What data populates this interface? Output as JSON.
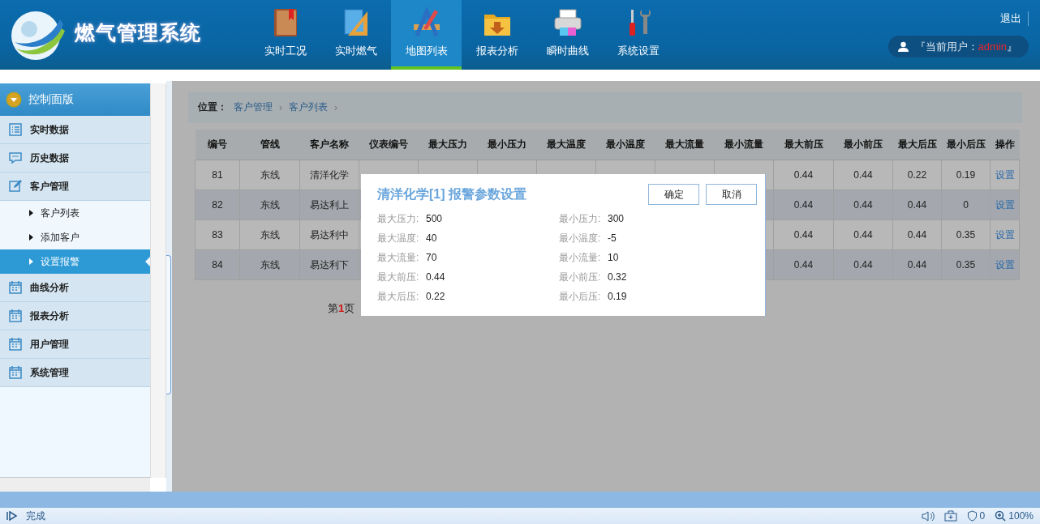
{
  "header": {
    "title": "燃气管理系统",
    "nav": [
      {
        "label": "实时工况",
        "selected": false
      },
      {
        "label": "实时燃气",
        "selected": false
      },
      {
        "label": "地图列表",
        "selected": true
      },
      {
        "label": "报表分析",
        "selected": false
      },
      {
        "label": "瞬时曲线",
        "selected": false
      },
      {
        "label": "系统设置",
        "selected": false
      }
    ],
    "logout": "退出",
    "user": {
      "prefix": "『当前用户：",
      "name": "admin",
      "suffix": "』"
    }
  },
  "sidebar": {
    "title": "控制面版",
    "items": [
      {
        "label": "实时数据"
      },
      {
        "label": "历史数据"
      },
      {
        "label": "客户管理",
        "children": [
          {
            "label": "客户列表",
            "selected": false
          },
          {
            "label": "添加客户",
            "selected": false
          },
          {
            "label": "设置报警",
            "selected": true
          }
        ]
      },
      {
        "label": "曲线分析"
      },
      {
        "label": "报表分析"
      },
      {
        "label": "用户管理"
      },
      {
        "label": "系统管理"
      }
    ]
  },
  "breadcrumb": {
    "label": "位置：",
    "items": [
      {
        "text": "客户管理",
        "kind": "link"
      },
      {
        "text": "›",
        "kind": "sep"
      },
      {
        "text": "客户列表",
        "kind": "link"
      },
      {
        "text": "›",
        "kind": "sep"
      }
    ]
  },
  "table": {
    "columns": [
      "编号",
      "管线",
      "客户名称",
      "仪表编号",
      "最大压力",
      "最小压力",
      "最大温度",
      "最小温度",
      "最大流量",
      "最小流量",
      "最大前压",
      "最小前压",
      "最大后压",
      "最小后压",
      "操作"
    ],
    "rows": [
      [
        "81",
        "东线",
        "清洋化学",
        null,
        null,
        null,
        null,
        null,
        null,
        null,
        "0.44",
        "0.44",
        "0.22",
        "0.19",
        "设置"
      ],
      [
        "82",
        "东线",
        "易达利上",
        null,
        null,
        null,
        null,
        null,
        null,
        null,
        "0.44",
        "0.44",
        "0.44",
        "0",
        "设置"
      ],
      [
        "83",
        "东线",
        "易达利中",
        null,
        null,
        null,
        null,
        null,
        null,
        null,
        "0.44",
        "0.44",
        "0.44",
        "0.35",
        "设置"
      ],
      [
        "84",
        "东线",
        "易达利下",
        null,
        null,
        null,
        null,
        null,
        null,
        null,
        "0.44",
        "0.44",
        "0.44",
        "0.35",
        "设置"
      ]
    ]
  },
  "pager": {
    "prefix": "第",
    "page": "1",
    "suffix": "页"
  },
  "dialog": {
    "title": "清洋化学[1] 报警参数设置",
    "buttons": [
      "确定",
      "取消"
    ],
    "fields": [
      {
        "label": "最大压力:",
        "value": "500"
      },
      {
        "label": "最小压力:",
        "value": "300"
      },
      {
        "label": "最大温度:",
        "value": "40"
      },
      {
        "label": "最小温度:",
        "value": "-5"
      },
      {
        "label": "最大流量:",
        "value": "70"
      },
      {
        "label": "最小流量:",
        "value": "10"
      },
      {
        "label": "最大前压:",
        "value": "0.44"
      },
      {
        "label": "最小前压:",
        "value": "0.32"
      },
      {
        "label": "最大后压:",
        "value": "0.22"
      },
      {
        "label": "最小后压:",
        "value": "0.19"
      }
    ]
  },
  "status_bar": {
    "text": "完成",
    "shield_count": "0",
    "zoom": "100%"
  }
}
